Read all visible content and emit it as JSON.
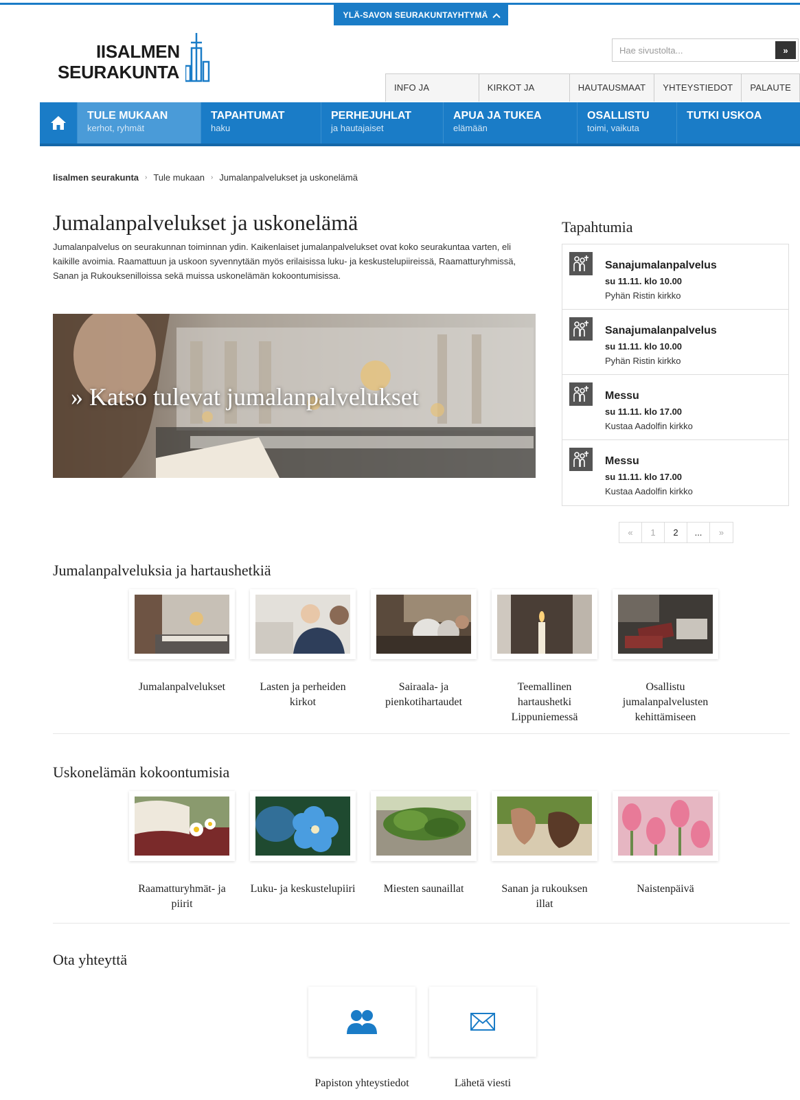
{
  "group_tab": "YLÄ-SAVON SEURAKUNTAYHTYMÄ",
  "logo": {
    "line1": "IISALMEN",
    "line2": "SEURAKUNTA"
  },
  "search": {
    "placeholder": "Hae sivustolta...",
    "button": "»"
  },
  "util_nav": [
    "INFO JA ASIOINTI",
    "KIRKOT JA TILAT",
    "HAUTAUSMAAT",
    "YHTEYSTIEDOT",
    "PALAUTE"
  ],
  "main_nav": [
    {
      "title": "TULE MUKAAN",
      "sub": "kerhot, ryhmät"
    },
    {
      "title": "TAPAHTUMAT",
      "sub": "haku"
    },
    {
      "title": "PERHEJUHLAT",
      "sub": "ja hautajaiset"
    },
    {
      "title": "APUA JA TUKEA",
      "sub": "elämään"
    },
    {
      "title": "OSALLISTU",
      "sub": "toimi, vaikuta"
    },
    {
      "title": "TUTKI USKOA",
      "sub": ""
    }
  ],
  "breadcrumb": [
    "Iisalmen seurakunta",
    "Tule mukaan",
    "Jumalanpalvelukset ja uskonelämä"
  ],
  "page_title": "Jumalanpalvelukset ja uskonelämä",
  "intro": "Jumalanpalvelus on seurakunnan toiminnan ydin. Kaikenlaiset jumalanpalvelukset ovat koko seurakuntaa varten, eli kaikille avoimia. Raamattuun ja uskoon syvennytään myös erilaisissa luku- ja keskustelupiireissä, Raamatturyhmissä, Sanan ja Rukouksenilloissa sekä muissa uskonelämän kokoontumisissa.",
  "hero_caption": "» Katso tulevat jumalanpalvelukset",
  "events_title": "Tapahtumia",
  "events": [
    {
      "title": "Sanajumalanpalvelus",
      "date": "su 11.11. klo 10.00",
      "place": "Pyhän Ristin kirkko"
    },
    {
      "title": "Sanajumalanpalvelus",
      "date": "su 11.11. klo 10.00",
      "place": "Pyhän Ristin kirkko"
    },
    {
      "title": "Messu",
      "date": "su 11.11. klo 17.00",
      "place": "Kustaa Aadolfin kirkko"
    },
    {
      "title": "Messu",
      "date": "su 11.11. klo 17.00",
      "place": "Kustaa Aadolfin kirkko"
    }
  ],
  "pager": [
    "«",
    "1",
    "2",
    "...",
    "»"
  ],
  "section1": {
    "title": "Jumalanpalveluksia ja hartaushetkiä",
    "items": [
      "Jumalanpalvelukset",
      "Lasten ja perheiden kirkot",
      "Sairaala- ja pienkotihartaudet",
      "Teemallinen hartaushetki Lippuniemessä",
      "Osallistu jumalanpalvelusten kehittämiseen"
    ]
  },
  "section2": {
    "title": "Uskonelämän kokoontumisia",
    "items": [
      "Raamatturyhmät- ja piirit",
      "Luku- ja keskustelupiiri",
      "Miesten saunaillat",
      "Sanan ja rukouksen illat",
      "Naistenpäivä"
    ]
  },
  "contact": {
    "title": "Ota yhteyttä",
    "items": [
      "Papiston yhteystiedot",
      "Lähetä viesti"
    ]
  },
  "colors": {
    "brand": "#1a7cc7",
    "nav_active": "#4a9bd8"
  }
}
